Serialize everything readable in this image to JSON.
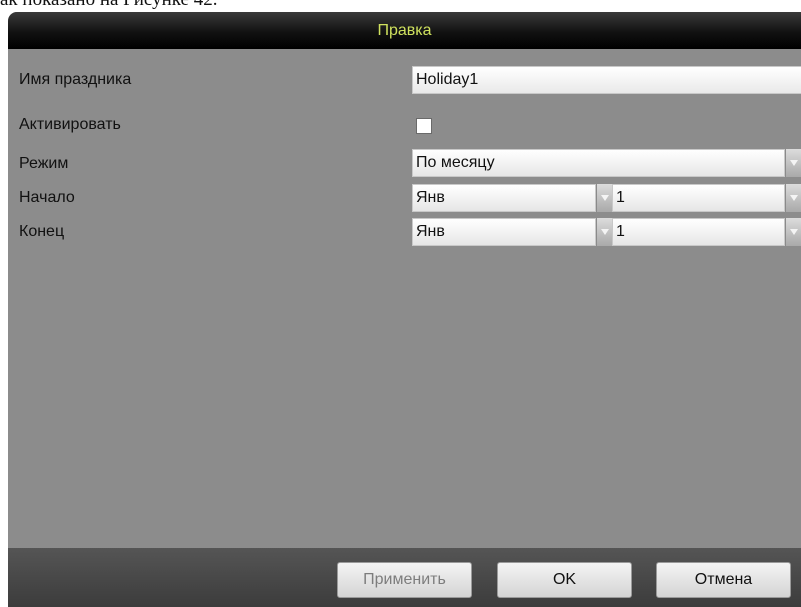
{
  "background_text": "ак показано на Рисунке 42.",
  "dialog": {
    "title": "Правка",
    "fields": {
      "holiday_name": {
        "label": "Имя праздника",
        "value": "Holiday1"
      },
      "activate": {
        "label": "Активировать",
        "checked": false
      },
      "mode": {
        "label": "Режим",
        "value": "По месяцу"
      },
      "start": {
        "label": "Начало",
        "month": "Янв",
        "day": "1"
      },
      "end": {
        "label": "Конец",
        "month": "Янв",
        "day": "1"
      }
    },
    "buttons": {
      "apply": "Применить",
      "ok": "OK",
      "cancel": "Отмена"
    }
  },
  "colors": {
    "title_text": "#cfe15e",
    "dialog_bg": "#8c8c8c",
    "footer_bg": "#444444"
  }
}
